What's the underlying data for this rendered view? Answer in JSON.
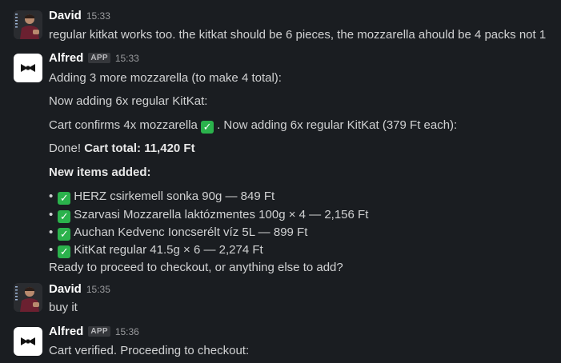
{
  "messages": [
    {
      "sender": "David",
      "time": "15:33",
      "text": "regular kitkat works too. the kitkat should be 6 pieces, the mozzarella ahould be 4 packs not 1"
    },
    {
      "sender": "Alfred",
      "badge": "APP",
      "time": "15:33",
      "lines": {
        "l1": "Adding 3 more mozzarella (to make 4 total):",
        "l2": "Now adding 6x regular KitKat:",
        "l3a": "Cart confirms 4x mozzarella ",
        "l3b": ". Now adding 6x regular KitKat (379 Ft each):",
        "l4a": "Done! ",
        "l4b": "Cart total: 11,420 Ft",
        "l5": "New items added:",
        "items": [
          "HERZ csirkemell sonka 90g — 849 Ft",
          "Szarvasi Mozzarella laktózmentes 100g × 4 — 2,156 Ft",
          "Auchan Kedvenc Ioncserélt víz 5L — 899 Ft",
          "KitKat regular 41.5g × 6 — 2,274 Ft"
        ],
        "l6": "Ready to proceed to checkout, or anything else to add?"
      }
    },
    {
      "sender": "David",
      "time": "15:35",
      "text": "buy it"
    },
    {
      "sender": "Alfred",
      "badge": "APP",
      "time": "15:36",
      "text": "Cart verified. Proceeding to checkout:"
    }
  ],
  "icons": {
    "check": "white-check-mark-icon",
    "bowtie": "bowtie-icon",
    "colors": {
      "check_green": "#2bb24c",
      "background": "#1a1d21"
    }
  }
}
